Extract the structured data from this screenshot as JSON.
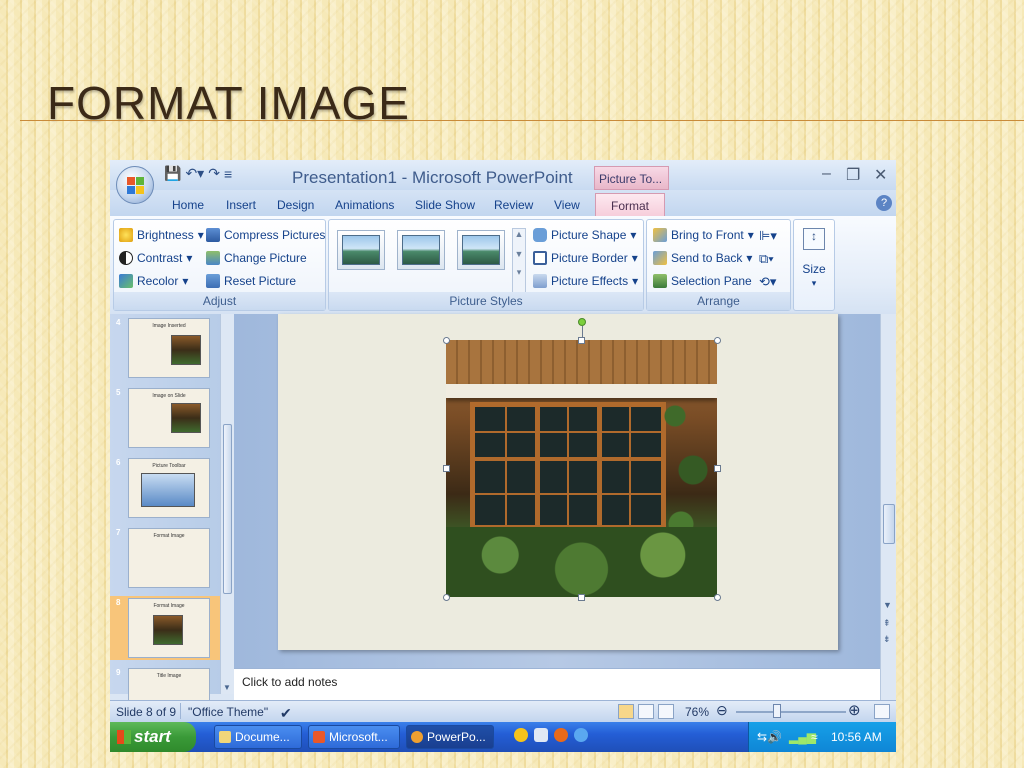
{
  "slide_title": "FORMAT IMAGE",
  "window": {
    "title": "Presentation1 - Microsoft PowerPoint",
    "context_tab": "Picture To...",
    "controls": [
      "–",
      "❐",
      "✕"
    ]
  },
  "tabs": [
    "Home",
    "Insert",
    "Design",
    "Animations",
    "Slide Show",
    "Review",
    "View",
    "Format"
  ],
  "ribbon": {
    "adjust": {
      "label": "Adjust",
      "brightness": "Brightness",
      "contrast": "Contrast",
      "recolor": "Recolor",
      "compress": "Compress Pictures",
      "change": "Change Picture",
      "reset": "Reset Picture"
    },
    "styles": {
      "label": "Picture Styles",
      "shape": "Picture Shape",
      "border": "Picture Border",
      "effects": "Picture Effects"
    },
    "arrange": {
      "label": "Arrange",
      "bring_front": "Bring to Front",
      "send_back": "Send to Back",
      "selection_pane": "Selection Pane"
    },
    "size": {
      "label": "Size"
    }
  },
  "thumbnails": [
    {
      "num": "4",
      "title": "Image Inserted"
    },
    {
      "num": "5",
      "title": "Image on Slide"
    },
    {
      "num": "6",
      "title": "Picture Toolbar"
    },
    {
      "num": "7",
      "title": "Format Image"
    },
    {
      "num": "8",
      "title": "Format Image"
    },
    {
      "num": "9",
      "title": "Title Image"
    }
  ],
  "notes_placeholder": "Click to add notes",
  "status": {
    "slide": "Slide 8 of 9",
    "theme": "\"Office Theme\"",
    "zoom": "76%"
  },
  "taskbar": {
    "start": "start",
    "items": [
      "Docume...",
      "Microsoft...",
      "PowerPo..."
    ],
    "clock": "10:56 AM"
  },
  "colors": {
    "accent": "#245ed6",
    "title": "#3b2a18",
    "context": "#e9b7c9"
  }
}
